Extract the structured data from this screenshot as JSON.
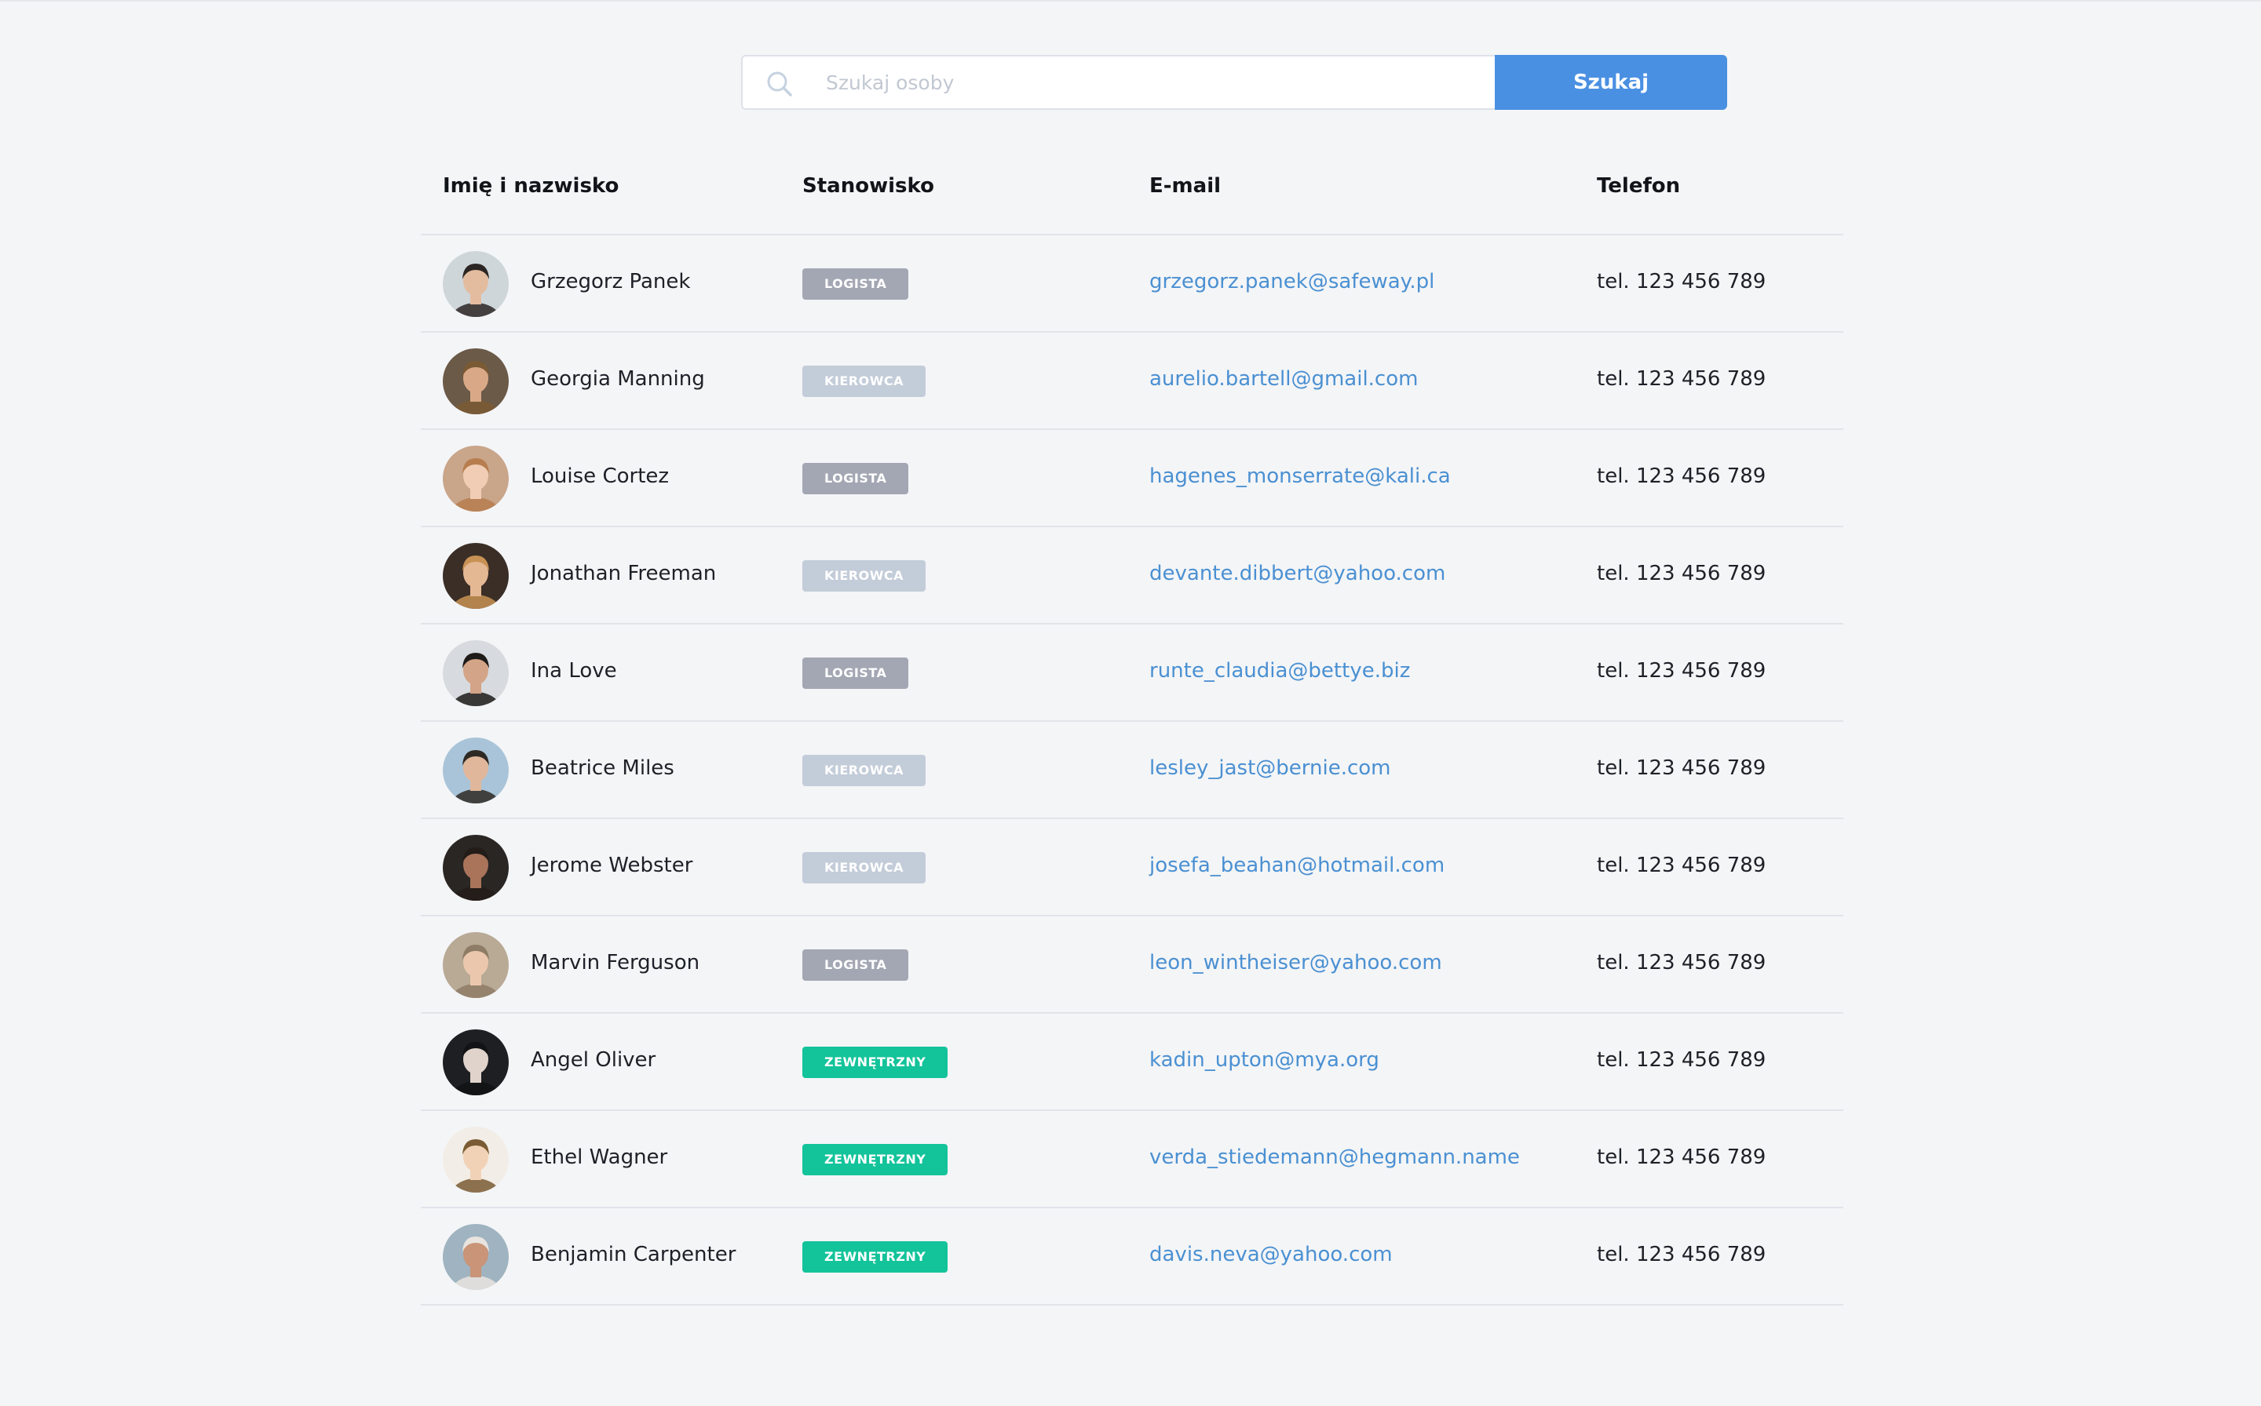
{
  "search": {
    "placeholder": "Szukaj osoby",
    "value": "",
    "button_label": "Szukaj"
  },
  "table": {
    "headers": {
      "name": "Imię i nazwisko",
      "position": "Stanowisko",
      "email": "E-mail",
      "phone": "Telefon"
    },
    "rows": [
      {
        "name": "Grzegorz Panek",
        "position": "LOGISTA",
        "email": "grzegorz.panek@safeway.pl",
        "phone": "tel. 123 456 789"
      },
      {
        "name": "Georgia Manning",
        "position": "KIEROWCA",
        "email": "aurelio.bartell@gmail.com",
        "phone": "tel. 123 456 789"
      },
      {
        "name": "Louise Cortez",
        "position": "LOGISTA",
        "email": "hagenes_monserrate@kali.ca",
        "phone": "tel. 123 456 789"
      },
      {
        "name": "Jonathan Freeman",
        "position": "KIEROWCA",
        "email": "devante.dibbert@yahoo.com",
        "phone": "tel. 123 456 789"
      },
      {
        "name": "Ina Love",
        "position": "LOGISTA",
        "email": "runte_claudia@bettye.biz",
        "phone": "tel. 123 456 789"
      },
      {
        "name": "Beatrice Miles",
        "position": "KIEROWCA",
        "email": "lesley_jast@bernie.com",
        "phone": "tel. 123 456 789"
      },
      {
        "name": "Jerome Webster",
        "position": "KIEROWCA",
        "email": "josefa_beahan@hotmail.com",
        "phone": "tel. 123 456 789"
      },
      {
        "name": "Marvin Ferguson",
        "position": "LOGISTA",
        "email": "leon_wintheiser@yahoo.com",
        "phone": "tel. 123 456 789"
      },
      {
        "name": "Angel Oliver",
        "position": "ZEWNĘTRZNY",
        "email": "kadin_upton@mya.org",
        "phone": "tel. 123 456 789"
      },
      {
        "name": "Ethel Wagner",
        "position": "ZEWNĘTRZNY",
        "email": "verda_stiedemann@hegmann.name",
        "phone": "tel. 123 456 789"
      },
      {
        "name": "Benjamin Carpenter",
        "position": "ZEWNĘTRZNY",
        "email": "davis.neva@yahoo.com",
        "phone": "tel. 123 456 789"
      }
    ]
  },
  "badge_colors": {
    "LOGISTA": "#a3a7b3",
    "KIEROWCA": "#c3ccd9",
    "ZEWNĘTRZNY": "#13c39a"
  },
  "avatars": [
    {
      "bg": "#cfd6da",
      "skin": "#e3bca0",
      "hair": "#2b2623"
    },
    {
      "bg": "#6b5a48",
      "skin": "#d9a987",
      "hair": "#7a5a35"
    },
    {
      "bg": "#c9a58a",
      "skin": "#f0cdb4",
      "hair": "#b77d4e"
    },
    {
      "bg": "#3a2e26",
      "skin": "#e5b894",
      "hair": "#c89254"
    },
    {
      "bg": "#d7dade",
      "skin": "#d3a487",
      "hair": "#1e1b19"
    },
    {
      "bg": "#a9c4d8",
      "skin": "#e0b79b",
      "hair": "#2e2925"
    },
    {
      "bg": "#2a2624",
      "skin": "#a9745a",
      "hair": "#231c18"
    },
    {
      "bg": "#b8aa95",
      "skin": "#ebc8ad",
      "hair": "#8e7c66"
    },
    {
      "bg": "#1d1f22",
      "skin": "#dfd3cc",
      "hair": "#121314"
    },
    {
      "bg": "#f2ede6",
      "skin": "#f2d2b6",
      "hair": "#7a5b33"
    },
    {
      "bg": "#9fb3c0",
      "skin": "#c99478",
      "hair": "#e9e4df"
    }
  ]
}
